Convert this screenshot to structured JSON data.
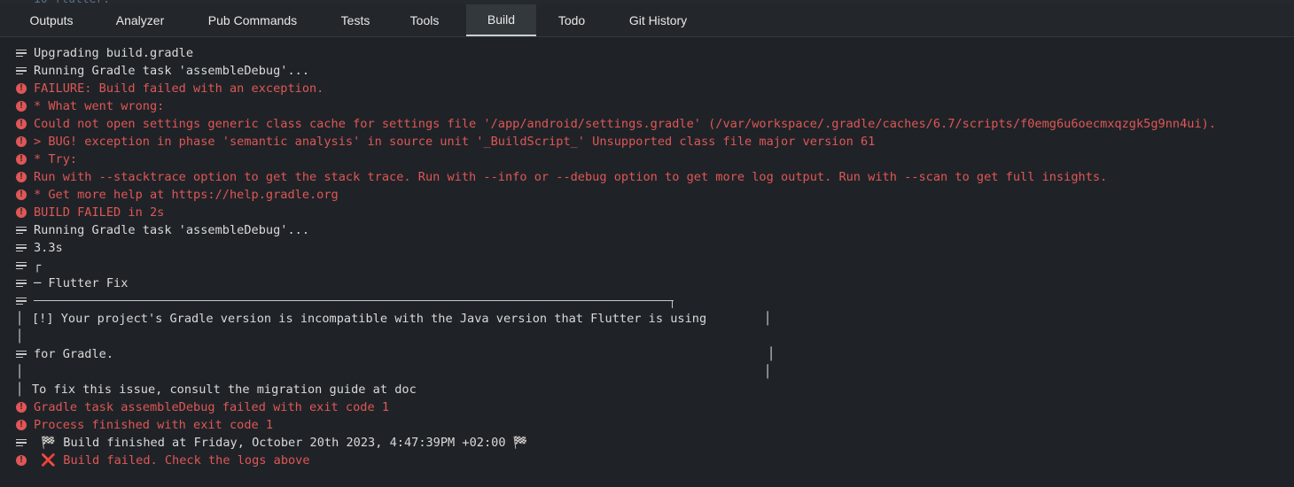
{
  "tabs": [
    {
      "label": "Outputs",
      "active": false
    },
    {
      "label": "Analyzer",
      "active": false
    },
    {
      "label": "Pub Commands",
      "active": false
    },
    {
      "label": "Tests",
      "active": false
    },
    {
      "label": "Tools",
      "active": false
    },
    {
      "label": "Build",
      "active": true
    },
    {
      "label": "Todo",
      "active": false
    },
    {
      "label": "Git History",
      "active": false
    }
  ],
  "console": {
    "lines": [
      {
        "level": "info",
        "text": "Upgrading build.gradle"
      },
      {
        "level": "info",
        "text": "Running Gradle task 'assembleDebug'..."
      },
      {
        "level": "error",
        "text": "FAILURE: Build failed with an exception."
      },
      {
        "level": "error",
        "text": "* What went wrong:"
      },
      {
        "level": "error",
        "text": "Could not open settings generic class cache for settings file '/app/android/settings.gradle' (/var/workspace/.gradle/caches/6.7/scripts/f0emg6u6oecmxqzgk5g9nn4ui)."
      },
      {
        "level": "error",
        "text": "> BUG! exception in phase 'semantic analysis' in source unit '_BuildScript_' Unsupported class file major version 61"
      },
      {
        "level": "error",
        "text": "* Try:"
      },
      {
        "level": "error",
        "text": "Run with --stacktrace option to get the stack trace. Run with --info or --debug option to get more log output. Run with --scan to get full insights."
      },
      {
        "level": "error",
        "text": "* Get more help at https://help.gradle.org"
      },
      {
        "level": "error",
        "text": "BUILD FAILED in 2s"
      },
      {
        "level": "info",
        "text": "Running Gradle task 'assembleDebug'..."
      },
      {
        "level": "info",
        "text": "3.3s"
      },
      {
        "level": "info",
        "text": "┌"
      },
      {
        "level": "info",
        "text": "─ Flutter Fix"
      },
      {
        "level": "info",
        "text": ""
      },
      {
        "level": "none",
        "text": "[!] Your project's Gradle version is incompatible with the Java version that Flutter is using"
      },
      {
        "level": "none",
        "text": ""
      },
      {
        "level": "info",
        "text": "for Gradle."
      },
      {
        "level": "none",
        "text": ""
      },
      {
        "level": "none",
        "text": "To fix this issue, consult the migration guide at doc"
      },
      {
        "level": "error",
        "text": "Gradle task assembleDebug failed with exit code 1"
      },
      {
        "level": "error",
        "text": "Process finished with exit code 1"
      },
      {
        "level": "info",
        "text": " 🏁 Build finished at Friday, October 20th 2023, 4:47:39PM +02:00 🏁"
      },
      {
        "level": "error",
        "text": " ❌ Build failed. Check the logs above"
      }
    ]
  },
  "colors": {
    "error": "#e05656",
    "info": "#d9d9d9",
    "background": "#1f2327",
    "tab_active": "#33383d"
  }
}
